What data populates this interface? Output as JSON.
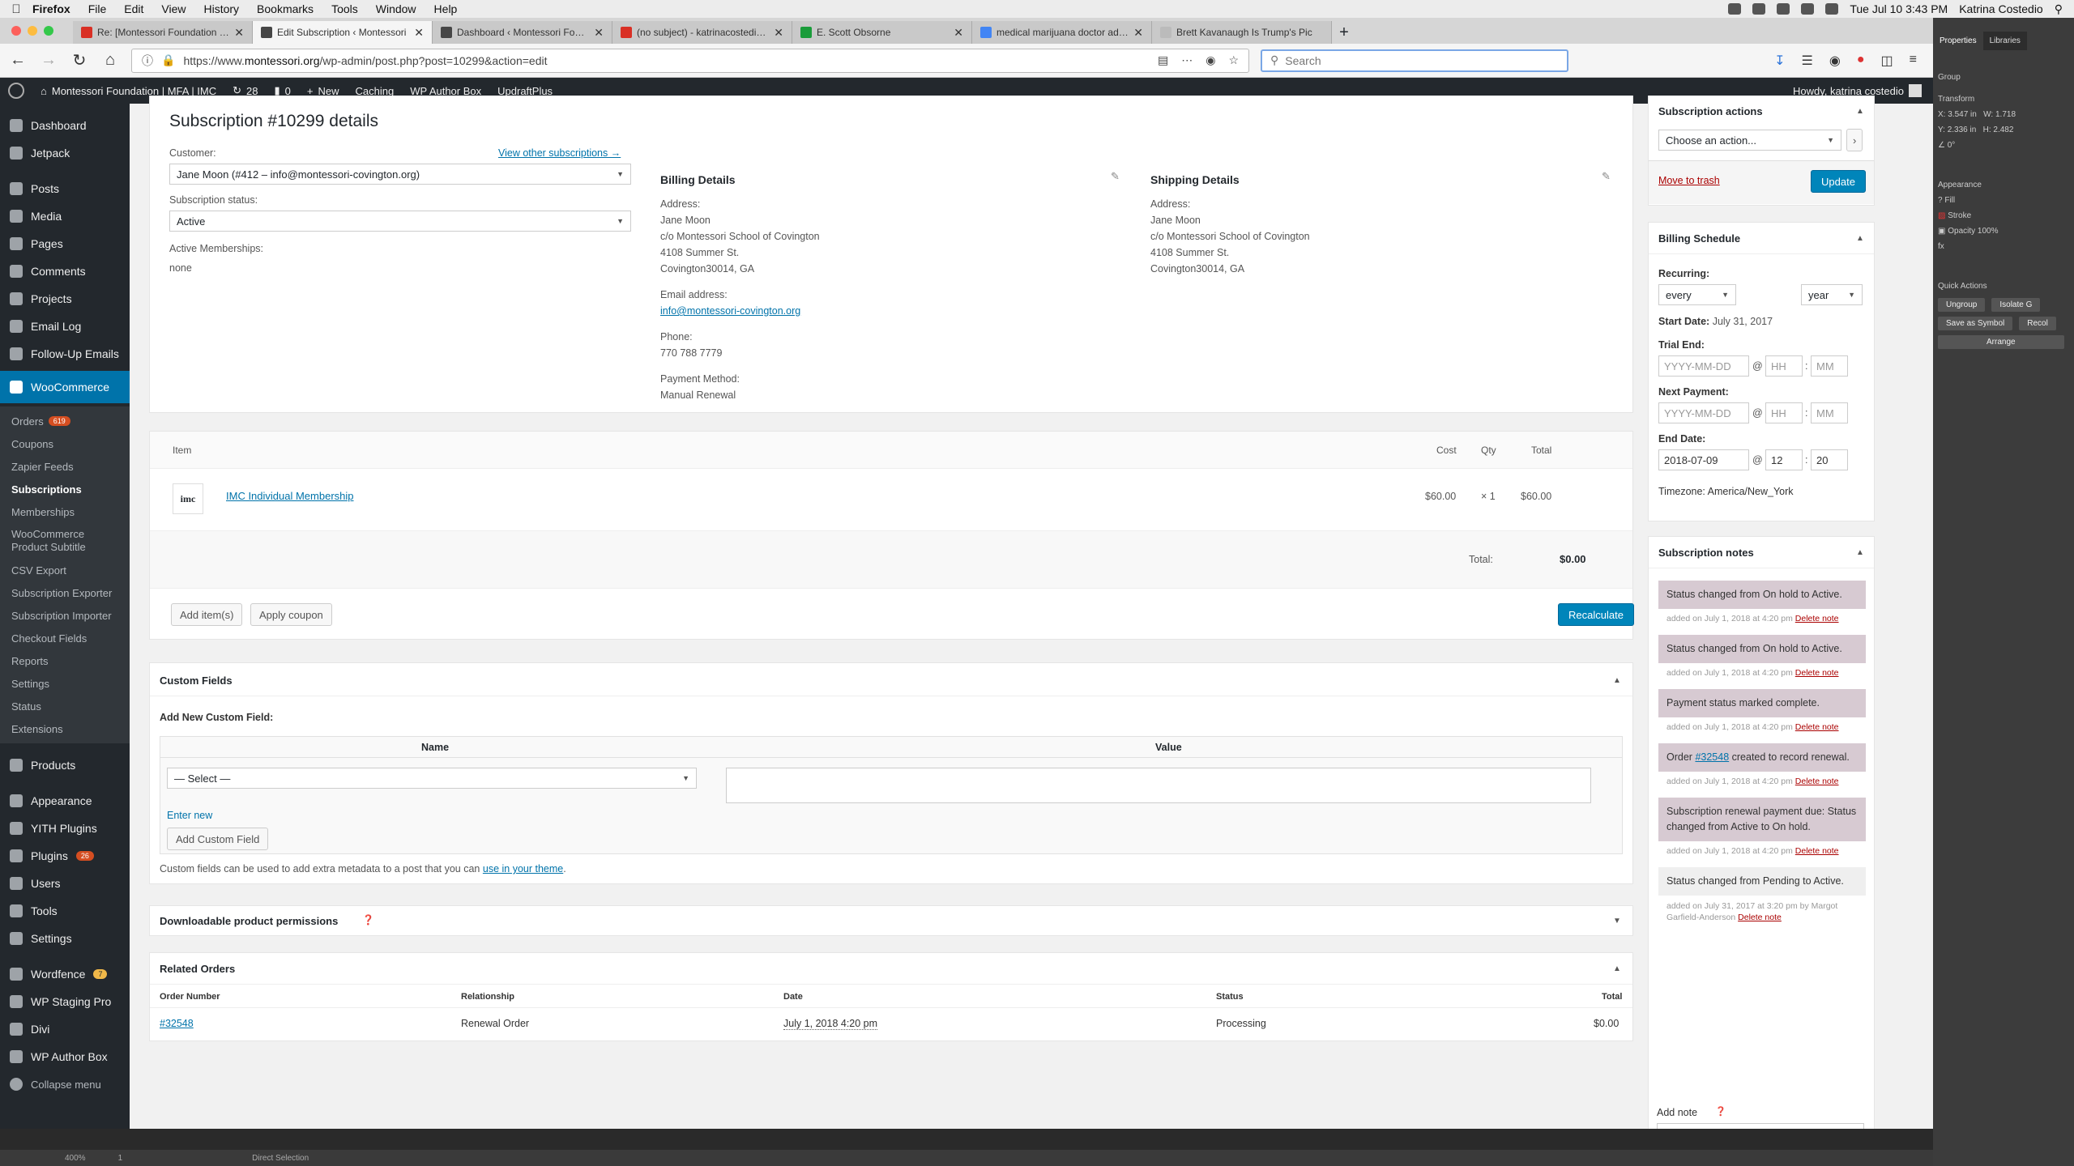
{
  "menubar": {
    "app": "Firefox",
    "items": [
      "File",
      "Edit",
      "View",
      "History",
      "Bookmarks",
      "Tools",
      "Window",
      "Help"
    ],
    "clock": "Tue Jul 10  3:43 PM",
    "user": "Katrina Costedio"
  },
  "tabs": [
    {
      "title": "Re: [Montessori Foundation | M"
    },
    {
      "title": "Edit Subscription ‹ Montessori"
    },
    {
      "title": "Dashboard ‹ Montessori Found"
    },
    {
      "title": "(no subject) - katrinacostedio@"
    },
    {
      "title": "E. Scott Obsorne"
    },
    {
      "title": "medical marijuana doctor ad - G"
    },
    {
      "title": "Brett Kavanaugh Is Trump's Pic"
    }
  ],
  "url": {
    "prefix": "https://www.",
    "domain": "montessori.org",
    "path": "/wp-admin/post.php?post=10299&action=edit"
  },
  "search": {
    "placeholder": "Search"
  },
  "adminbar": {
    "site": "Montessori Foundation | MFA | IMC",
    "updates": "28",
    "comments": "0",
    "new": "New",
    "caching": "Caching",
    "author_box": "WP Author Box",
    "updraft": "UpdraftPlus",
    "howdy": "Howdy, katrina costedio"
  },
  "sidebar": {
    "top": [
      {
        "label": "Dashboard"
      },
      {
        "label": "Jetpack"
      }
    ],
    "group2": [
      {
        "label": "Posts"
      },
      {
        "label": "Media"
      },
      {
        "label": "Pages"
      },
      {
        "label": "Comments"
      },
      {
        "label": "Projects"
      },
      {
        "label": "Email Log"
      },
      {
        "label": "Follow-Up Emails"
      }
    ],
    "woocommerce": "WooCommerce",
    "woo_sub": [
      {
        "label": "Orders",
        "badge": "619"
      },
      {
        "label": "Coupons"
      },
      {
        "label": "Zapier Feeds"
      },
      {
        "label": "Subscriptions"
      },
      {
        "label": "Memberships"
      },
      {
        "label": "WooCommerce Product Subtitle"
      },
      {
        "label": "CSV Export"
      },
      {
        "label": "Subscription Exporter"
      },
      {
        "label": "Subscription Importer"
      },
      {
        "label": "Checkout Fields"
      },
      {
        "label": "Reports"
      },
      {
        "label": "Settings"
      },
      {
        "label": "Status"
      },
      {
        "label": "Extensions"
      }
    ],
    "bottom": [
      {
        "label": "Products"
      },
      {
        "label": "Appearance"
      },
      {
        "label": "YITH Plugins"
      },
      {
        "label": "Plugins",
        "badge": "26"
      },
      {
        "label": "Users"
      },
      {
        "label": "Tools"
      },
      {
        "label": "Settings"
      },
      {
        "label": "Wordfence",
        "badge": "7"
      },
      {
        "label": "WP Staging Pro"
      },
      {
        "label": "Divi"
      },
      {
        "label": "WP Author Box"
      },
      {
        "label": "Collapse menu"
      }
    ]
  },
  "details": {
    "title": "Subscription #10299 details",
    "customer_label": "Customer:",
    "view_other": "View other subscriptions →",
    "customer_value": "Jane Moon (#412 – info@montessori-covington.org)",
    "status_label": "Subscription status:",
    "status_value": "Active",
    "memberships_label": "Active Memberships:",
    "memberships_value": "none",
    "billing": {
      "heading": "Billing Details",
      "address_label": "Address:",
      "address": [
        "Jane Moon",
        "c/o Montessori School of Covington",
        "4108 Summer St.",
        "Covington30014, GA"
      ],
      "email_label": "Email address:",
      "email": "info@montessori-covington.org",
      "phone_label": "Phone:",
      "phone": "770 788 7779",
      "payment_label": "Payment Method:",
      "payment": "Manual Renewal"
    },
    "shipping": {
      "heading": "Shipping Details",
      "address_label": "Address:",
      "address": [
        "Jane Moon",
        "c/o Montessori School of Covington",
        "4108 Summer St.",
        "Covington30014, GA"
      ]
    }
  },
  "items": {
    "headers": {
      "item": "Item",
      "cost": "Cost",
      "qty": "Qty",
      "total": "Total"
    },
    "thumb": "imc",
    "name": "IMC Individual Membership",
    "cost": "$60.00",
    "qty": "× 1",
    "line_total": "$60.00",
    "total_label": "Total:",
    "total_value": "$0.00",
    "add_items": "Add item(s)",
    "apply_coupon": "Apply coupon",
    "recalculate": "Recalculate"
  },
  "custom_fields": {
    "heading": "Custom Fields",
    "add_new": "Add New Custom Field:",
    "col_name": "Name",
    "col_value": "Value",
    "select": "— Select —",
    "enter_new": "Enter new",
    "add_button": "Add Custom Field",
    "help_prefix": "Custom fields can be used to add extra metadata to a post that you can",
    "help_link": "use in your theme",
    "help_suffix": "."
  },
  "downloads": {
    "heading": "Downloadable product permissions"
  },
  "related": {
    "heading": "Related Orders",
    "headers": {
      "number": "Order Number",
      "relationship": "Relationship",
      "date": "Date",
      "status": "Status",
      "total": "Total"
    },
    "rows": [
      {
        "number": "#32548",
        "relationship": "Renewal Order",
        "date": "July 1, 2018 4:20 pm",
        "status": "Processing",
        "total": "$0.00"
      }
    ]
  },
  "actions": {
    "heading": "Subscription actions",
    "choose": "Choose an action...",
    "trash": "Move to trash",
    "update": "Update"
  },
  "schedule": {
    "heading": "Billing Schedule",
    "recurring_label": "Recurring:",
    "interval": "every",
    "period": "year",
    "start_label": "Start Date:",
    "start_value": "July 31, 2017",
    "trial_label": "Trial End:",
    "next_label": "Next Payment:",
    "end_label": "End Date:",
    "date_placeholder": "YYYY-MM-DD",
    "hh_placeholder": "HH",
    "mm_placeholder": "MM",
    "end_date": "2018-07-09",
    "end_hh": "12",
    "end_mm": "20",
    "timezone": "Timezone: America/New_York"
  },
  "notes": {
    "heading": "Subscription notes",
    "items": [
      {
        "text": "Status changed from On hold to Active.",
        "meta": "added on July 1, 2018 at 4:20 pm",
        "del": "Delete note"
      },
      {
        "text": "Status changed from On hold to Active.",
        "meta": "added on July 1, 2018 at 4:20 pm",
        "del": "Delete note"
      },
      {
        "text": "Payment status marked complete.",
        "meta": "added on July 1, 2018 at 4:20 pm",
        "del": "Delete note"
      },
      {
        "text_prefix": "Order ",
        "link": "#32548",
        "text_suffix": " created to record renewal.",
        "meta": "added on July 1, 2018 at 4:20 pm",
        "del": "Delete note"
      },
      {
        "text": "Subscription renewal payment due: Status changed from Active to On hold.",
        "meta": "added on July 1, 2018 at 4:20 pm",
        "del": "Delete note"
      },
      {
        "text": "Status changed from Pending to Active.",
        "meta": "added on July 31, 2017 at 3:20 pm by Margot Garfield-Anderson",
        "del": "Delete note"
      }
    ],
    "add_note": "Add note"
  },
  "panel": {
    "tabs": [
      "Properties",
      "Libraries"
    ],
    "group": "Group",
    "transform": "Transform",
    "x": "3.547 in",
    "w": "1.718",
    "y": "2.336 in",
    "h": "2.482",
    "angle": "0°",
    "appearance": "Appearance",
    "fill": "Fill",
    "stroke": "Stroke",
    "opacity": "Opacity",
    "opacity_val": "100%",
    "quick_actions": "Quick Actions",
    "ungroup": "Ungroup",
    "isolate": "Isolate G",
    "save_symbol": "Save as Symbol",
    "recolor": "Recol",
    "arrange": "Arrange"
  },
  "bottombar": {
    "zoom": "400%",
    "page": "1",
    "tool": "Direct Selection"
  }
}
